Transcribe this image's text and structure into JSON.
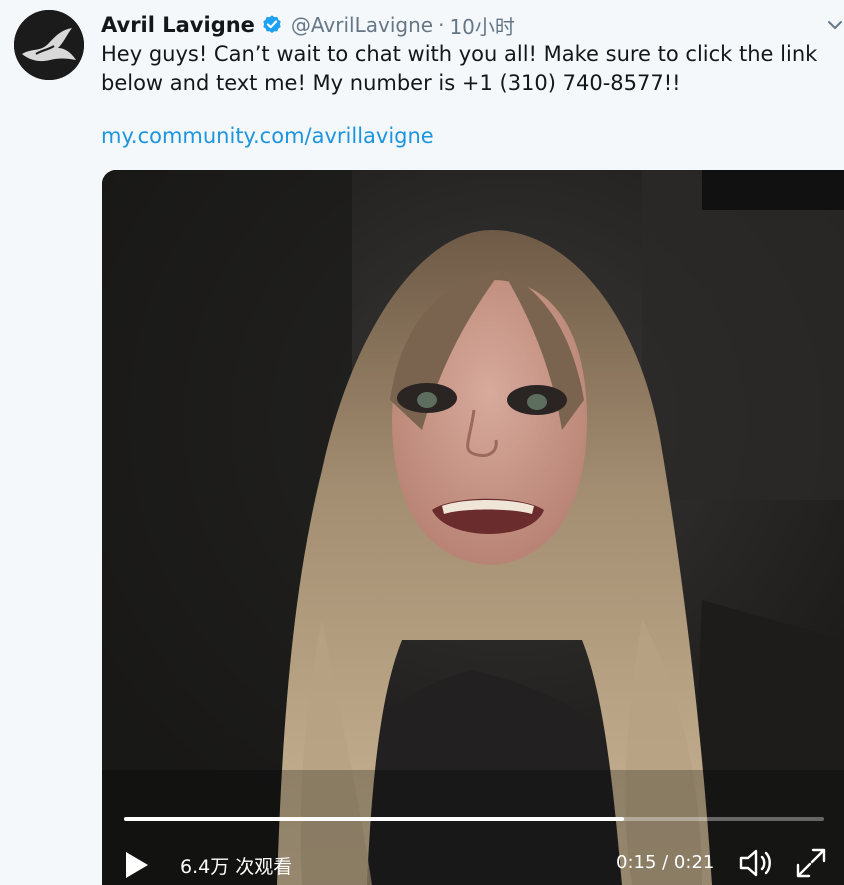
{
  "tweet": {
    "author_name": "Avril Lavigne",
    "handle": "@AvrilLavigne",
    "separator": "·",
    "time": "10小时",
    "text_lines": [
      "Hey guys! Can’t wait to chat with you all! Make sure to click the link",
      "below and text me! My number is +1 (310) 740-8577!!"
    ],
    "link": "my.community.com/avrillavigne"
  },
  "video": {
    "views": "6.4万 次观看",
    "timecode": "0:15 / 0:21",
    "progress": 0.714
  },
  "icons": {
    "verified": "verified-badge-icon",
    "caret": "chevron-down-icon",
    "play": "play-icon",
    "volume": "volume-icon",
    "expand": "fullscreen-icon"
  },
  "colors": {
    "background": "#f5f8fa",
    "link": "#1b95e0",
    "verified": "#1da1f2",
    "secondary_text": "#657786"
  }
}
